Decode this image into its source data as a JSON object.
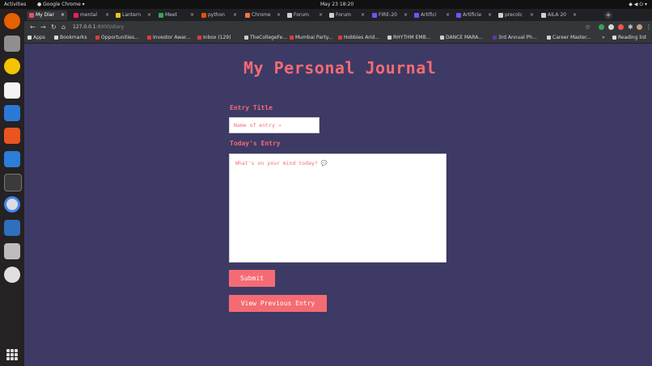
{
  "system": {
    "activities": "Activities",
    "app_name": "Google Chrome",
    "clock": "May 23  18:20"
  },
  "browser": {
    "tabs": [
      {
        "label": "My Diar",
        "color": "#e94e61",
        "active": true
      },
      {
        "label": "mental",
        "color": "#e91e63"
      },
      {
        "label": "Lantern",
        "color": "#f4c20d"
      },
      {
        "label": "Meet",
        "color": "#34a853"
      },
      {
        "label": "python",
        "color": "#e65100"
      },
      {
        "label": "Chrome",
        "color": "#ff7043"
      },
      {
        "label": "Forum",
        "color": "#cfcfcf"
      },
      {
        "label": "Forum",
        "color": "#cfcfcf"
      },
      {
        "label": "FIRE-20",
        "color": "#7c4dff"
      },
      {
        "label": "Artifici",
        "color": "#7c4dff"
      },
      {
        "label": "Artificie",
        "color": "#7c4dff"
      },
      {
        "label": "precolc",
        "color": "#cfcfcf"
      },
      {
        "label": "AILA 20",
        "color": "#cfcfcf"
      }
    ],
    "new_tab": "+",
    "url_host": "127.0.0.1",
    "url_rest": ":8000/diary",
    "bookmarks": [
      {
        "label": "Apps",
        "color": "#dcdcdc"
      },
      {
        "label": "Bookmarks",
        "color": "#dcdcdc"
      },
      {
        "label": "Opportunities...",
        "color": "#e53935"
      },
      {
        "label": "Investor Awar...",
        "color": "#e53935"
      },
      {
        "label": "Inbox (129)",
        "color": "#e53935"
      },
      {
        "label": "TheCollegeFe...",
        "color": "#cfcfcf"
      },
      {
        "label": "Mumbai Party...",
        "color": "#e53935"
      },
      {
        "label": "Hobbies Arid...",
        "color": "#e53935"
      },
      {
        "label": "RHYTHM EMB...",
        "color": "#cfcfcf"
      },
      {
        "label": "DANCE MARA...",
        "color": "#cfcfcf"
      },
      {
        "label": "3rd Annual Ph...",
        "color": "#5e35b1"
      },
      {
        "label": "Career Master...",
        "color": "#cfcfcf"
      },
      {
        "label": "Reading list",
        "color": "#dcdcdc"
      }
    ],
    "more": "»"
  },
  "page": {
    "title": "My Personal Journal",
    "entry_title_label": "Entry Title",
    "entry_title_placeholder": "Name of entry →",
    "entry_label": "Today's Entry",
    "entry_placeholder": "What's on your mind today? 💬",
    "submit_label": "Submit",
    "view_previous_label": "View Previous Entry"
  },
  "colors": {
    "background": "#3d3a66",
    "accent": "#f56b73"
  }
}
